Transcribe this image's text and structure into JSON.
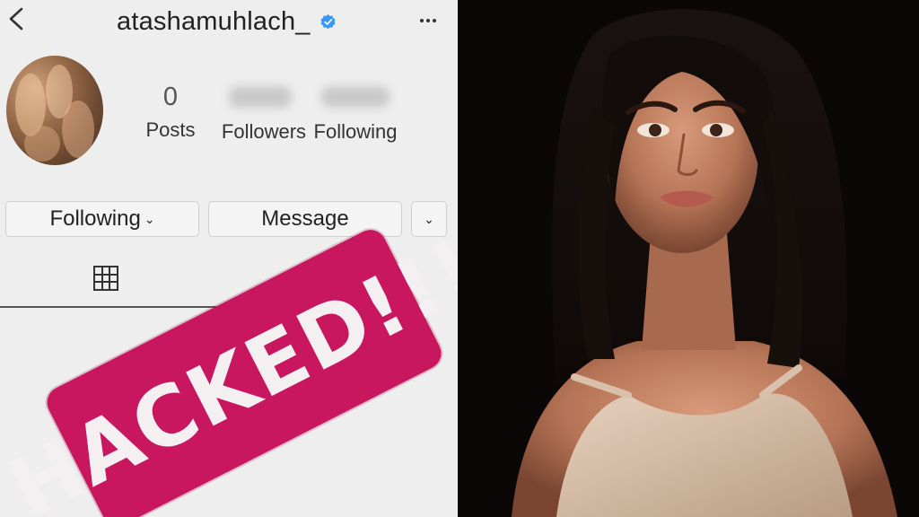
{
  "profile": {
    "username": "atashamuhlach_",
    "verified_icon": "verified-badge-icon",
    "stats": {
      "posts_count": "0",
      "posts_label": "Posts",
      "followers_label": "Followers",
      "following_label": "Following"
    },
    "buttons": {
      "following_label": "Following",
      "message_label": "Message"
    }
  },
  "overlay": {
    "stamp_text": "HACKED!!!",
    "stamp_color": "#c8175f"
  },
  "colors": {
    "verified": "#3897f0",
    "background": "#eeeeee"
  }
}
